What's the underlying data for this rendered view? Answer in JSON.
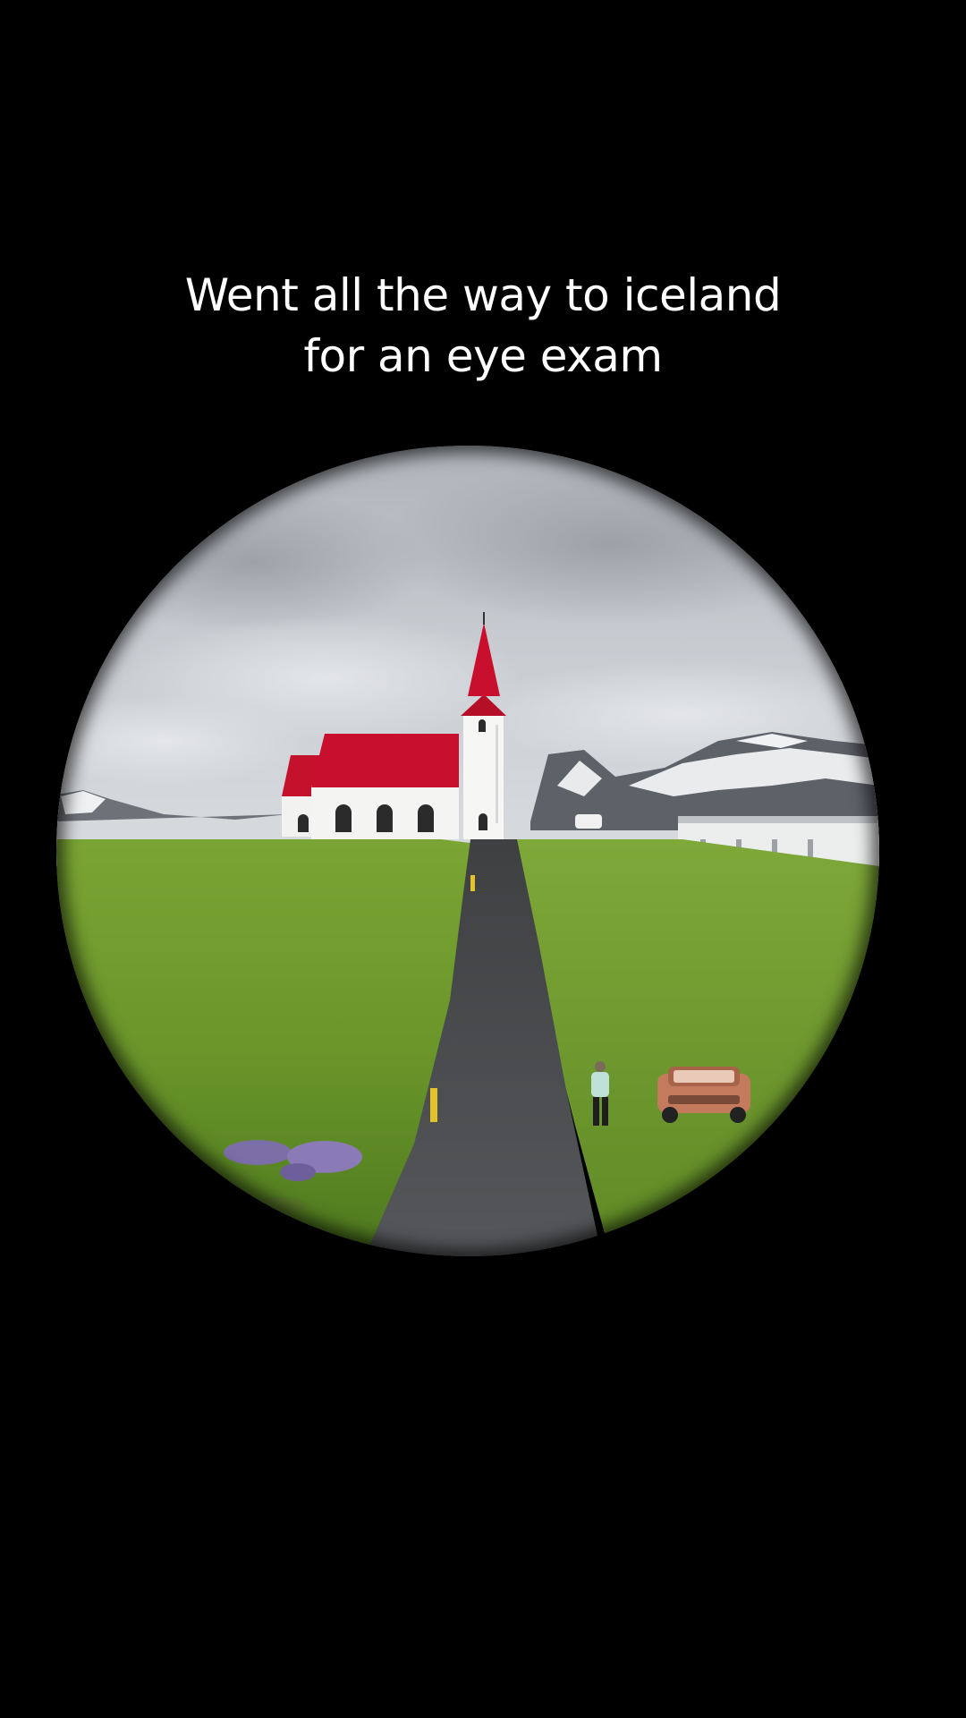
{
  "caption": {
    "line1": "Went all the way to iceland",
    "line2": "for an eye exam"
  },
  "colors": {
    "background": "#000000",
    "caption_text": "#ffffff",
    "church_roof": "#c8102e",
    "church_wall": "#f4f4f2",
    "grass": "#6e9a2c",
    "road": "#4a4b4d",
    "sky": "#c9cdd2",
    "car": "#c97a5a"
  }
}
